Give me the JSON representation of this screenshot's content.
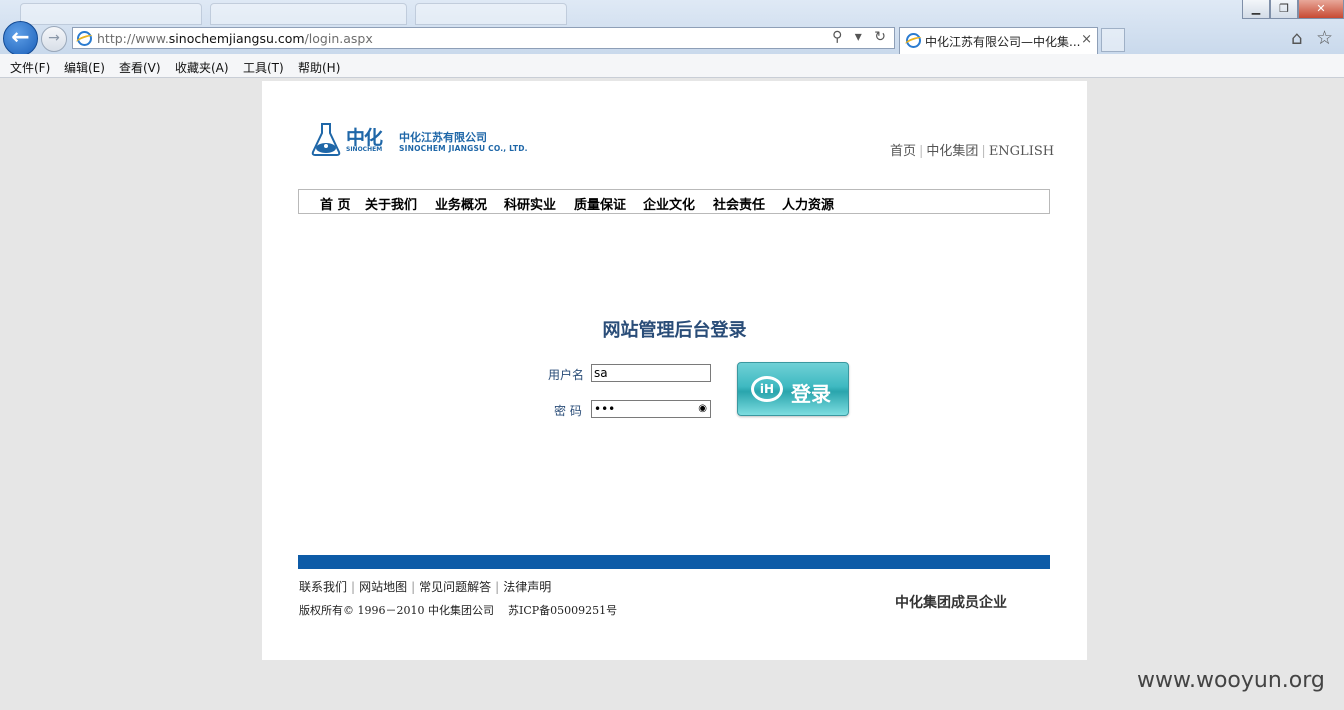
{
  "browser": {
    "url_prefix": "http://www.",
    "url_domain": "sinochemjiangsu.com",
    "url_path": "/login.aspx",
    "tab_title": "中化江苏有限公司—中化集...",
    "tab_close": "×",
    "window_controls": {
      "minimize": "▁",
      "restore": "❐",
      "close": "✕"
    },
    "back": "←",
    "forward": "→",
    "addr_icons": "⚲ ▾ ↻",
    "home_icon": "⌂",
    "favorites_icon": "☆",
    "menu": [
      "文件(F)",
      "编辑(E)",
      "查看(V)",
      "收藏夹(A)",
      "工具(T)",
      "帮助(H)"
    ]
  },
  "site": {
    "logo": {
      "brand_cn": "中化",
      "brand_en": "SINOCHEM",
      "company_cn": "中化江苏有限公司",
      "company_en": "SINOCHEM JIANGSU CO., LTD."
    },
    "top_links": [
      "首页",
      "中化集团",
      "ENGLISH"
    ],
    "nav": [
      "首 页",
      "关于我们",
      "业务概况",
      "科研实业",
      "质量保证",
      "企业文化",
      "社会责任",
      "人力资源"
    ]
  },
  "login": {
    "title": "网站管理后台登录",
    "username_label": "用户名",
    "username_value": "sa",
    "password_label": "密 码",
    "password_value": "•••",
    "button_label": "登录",
    "button_logo": "iH"
  },
  "footer": {
    "links": [
      "联系我们",
      "网站地图",
      "常见问题解答",
      "法律声明"
    ],
    "copyright": "版权所有© 1996－2010 中化集团公司",
    "icp": "苏ICP备05009251号",
    "member": "中化集团成员企业"
  },
  "watermark": "www.wooyun.org",
  "colors": {
    "brand_blue": "#1f67a8",
    "footer_bar": "#0d5ba7",
    "button_teal": "#3fb9c1"
  }
}
